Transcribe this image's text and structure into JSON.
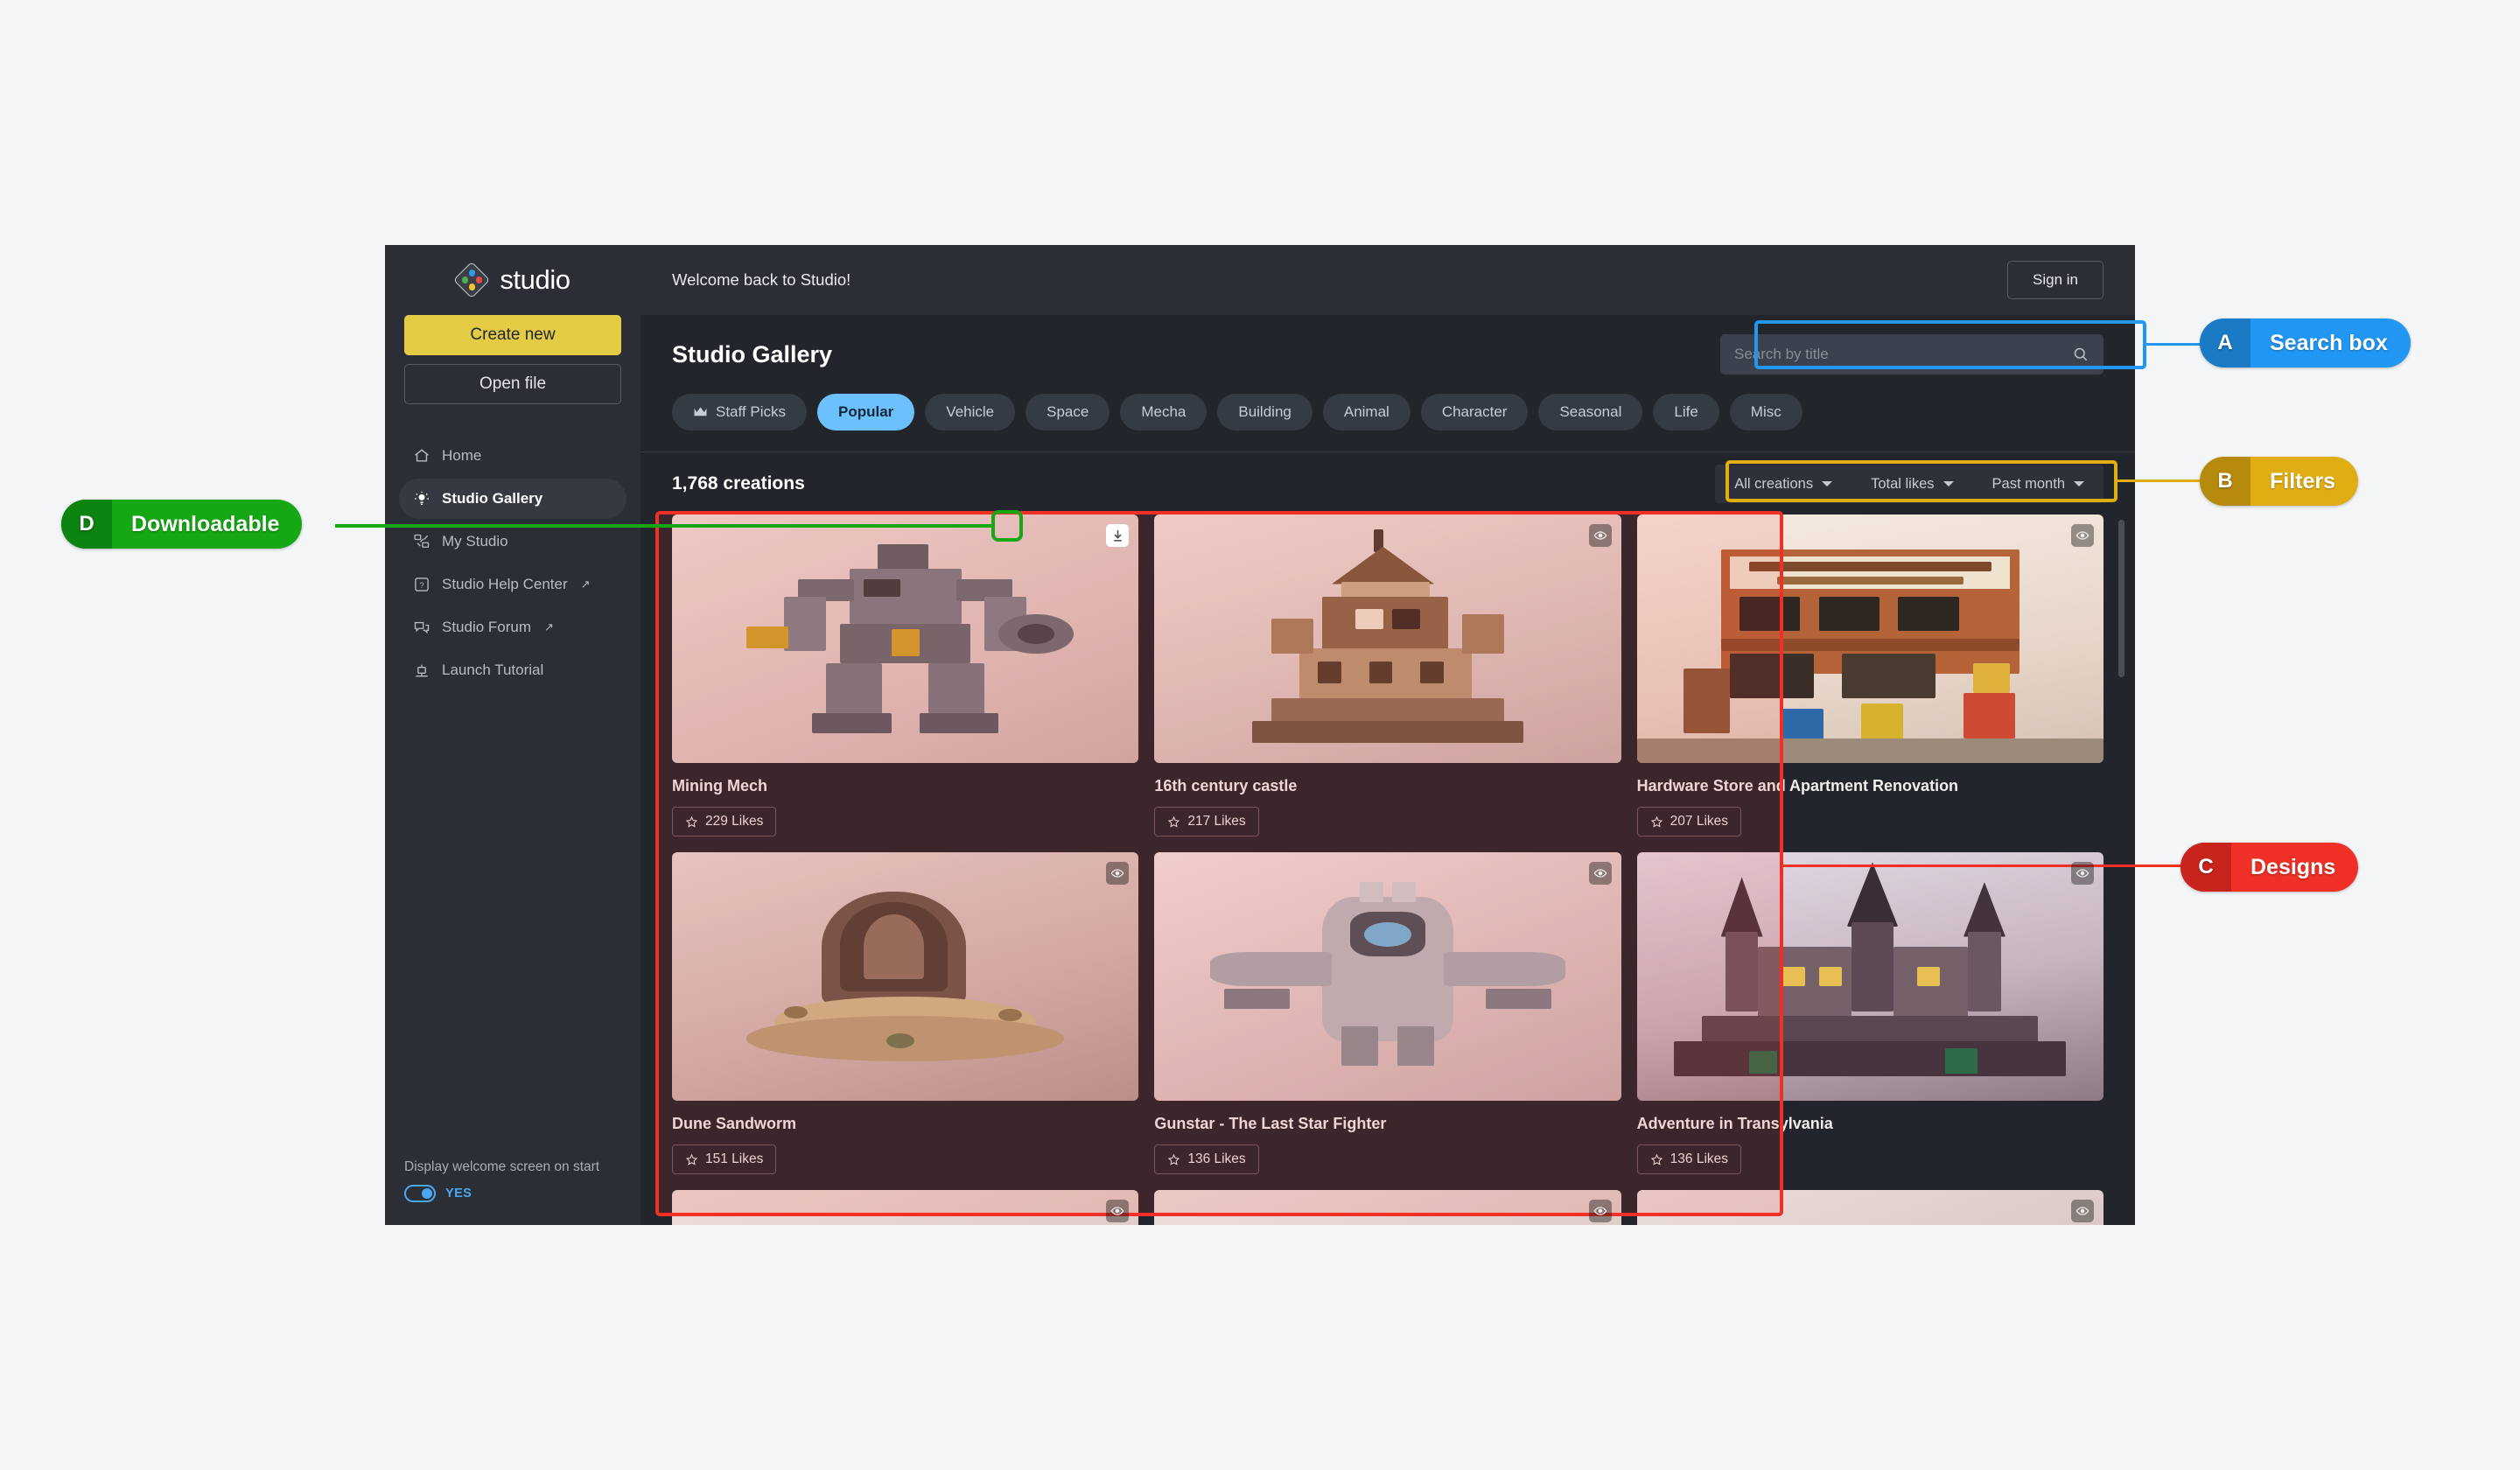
{
  "app": {
    "brand": "studio",
    "sidebar": {
      "create_label": "Create new",
      "open_label": "Open file",
      "items": [
        {
          "label": "Home",
          "icon": "home-icon",
          "active": false,
          "external": false
        },
        {
          "label": "Studio Gallery",
          "icon": "lightbulb-icon",
          "active": true,
          "external": false
        },
        {
          "label": "My Studio",
          "icon": "bricks-icon",
          "active": false,
          "external": false
        },
        {
          "label": "Studio Help Center",
          "icon": "help-icon",
          "active": false,
          "external": true
        },
        {
          "label": "Studio Forum",
          "icon": "chat-icon",
          "active": false,
          "external": true
        },
        {
          "label": "Launch Tutorial",
          "icon": "tutorial-icon",
          "active": false,
          "external": false
        }
      ],
      "footer": {
        "label": "Display welcome screen on start",
        "toggle_value": "YES",
        "toggle_on": true
      }
    },
    "topbar": {
      "welcome": "Welcome back to Studio!",
      "signin_label": "Sign in"
    },
    "gallery": {
      "title": "Studio Gallery",
      "search": {
        "placeholder": "Search by title",
        "value": "",
        "icon": "search-icon"
      },
      "chips": [
        {
          "label": "Staff Picks",
          "icon": "crown-icon",
          "active": false
        },
        {
          "label": "Popular",
          "active": true
        },
        {
          "label": "Vehicle",
          "active": false
        },
        {
          "label": "Space",
          "active": false
        },
        {
          "label": "Mecha",
          "active": false
        },
        {
          "label": "Building",
          "active": false
        },
        {
          "label": "Animal",
          "active": false
        },
        {
          "label": "Character",
          "active": false
        },
        {
          "label": "Seasonal",
          "active": false
        },
        {
          "label": "Life",
          "active": false
        },
        {
          "label": "Misc",
          "active": false
        }
      ],
      "count_label": "1,768 creations",
      "filters": [
        {
          "label": "All creations",
          "icon": "chevron-down-icon"
        },
        {
          "label": "Total likes",
          "icon": "chevron-down-icon"
        },
        {
          "label": "Past month",
          "icon": "chevron-down-icon"
        }
      ],
      "cards": [
        {
          "title": "Mining Mech",
          "likes": "229 Likes",
          "badge": "download-icon",
          "art": "mech"
        },
        {
          "title": "16th century castle",
          "likes": "217 Likes",
          "badge": "eye-icon",
          "art": "castle"
        },
        {
          "title": "Hardware Store and Apartment Renovation",
          "likes": "207 Likes",
          "badge": "eye-icon",
          "art": "store"
        },
        {
          "title": "Dune Sandworm",
          "likes": "151 Likes",
          "badge": "eye-icon",
          "art": "sandworm"
        },
        {
          "title": "Gunstar - The Last Star Fighter",
          "likes": "136 Likes",
          "badge": "eye-icon",
          "art": "gunstar"
        },
        {
          "title": "Adventure in Transylvania",
          "likes": "136 Likes",
          "badge": "eye-icon",
          "art": "transylvania"
        }
      ]
    }
  },
  "annotations": [
    {
      "key": "A",
      "label": "Search box",
      "color": "#2196F3",
      "dark": "#1a7ac4"
    },
    {
      "key": "B",
      "label": "Filters",
      "color": "#E0AE12",
      "dark": "#b58a0d"
    },
    {
      "key": "C",
      "label": "Designs",
      "color": "#F03027",
      "dark": "#c6241d"
    },
    {
      "key": "D",
      "label": "Downloadable",
      "color": "#15A714",
      "dark": "#0d8310"
    }
  ]
}
